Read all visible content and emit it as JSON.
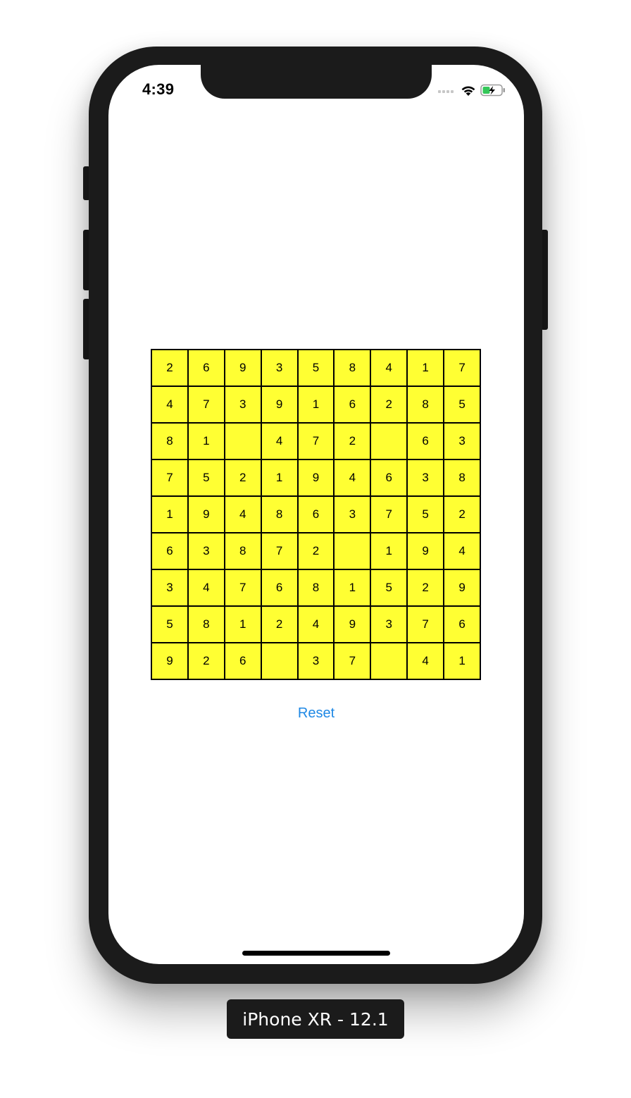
{
  "status_bar": {
    "time": "4:39"
  },
  "board": {
    "cells": [
      [
        "2",
        "6",
        "9",
        "3",
        "5",
        "8",
        "4",
        "1",
        "7"
      ],
      [
        "4",
        "7",
        "3",
        "9",
        "1",
        "6",
        "2",
        "8",
        "5"
      ],
      [
        "8",
        "1",
        "",
        "4",
        "7",
        "2",
        "",
        "6",
        "3"
      ],
      [
        "7",
        "5",
        "2",
        "1",
        "9",
        "4",
        "6",
        "3",
        "8"
      ],
      [
        "1",
        "9",
        "4",
        "8",
        "6",
        "3",
        "7",
        "5",
        "2"
      ],
      [
        "6",
        "3",
        "8",
        "7",
        "2",
        "",
        "1",
        "9",
        "4"
      ],
      [
        "3",
        "4",
        "7",
        "6",
        "8",
        "1",
        "5",
        "2",
        "9"
      ],
      [
        "5",
        "8",
        "1",
        "2",
        "4",
        "9",
        "3",
        "7",
        "6"
      ],
      [
        "9",
        "2",
        "6",
        "",
        "3",
        "7",
        "",
        "4",
        "1"
      ]
    ],
    "cell_color": "#ffff33"
  },
  "reset_button": {
    "label": "Reset",
    "color": "#1e88e5"
  },
  "simulator": {
    "device_label": "iPhone XR - 12.1"
  },
  "icons": [
    "cellular-signal-icon",
    "wifi-icon",
    "battery-charging-icon"
  ]
}
